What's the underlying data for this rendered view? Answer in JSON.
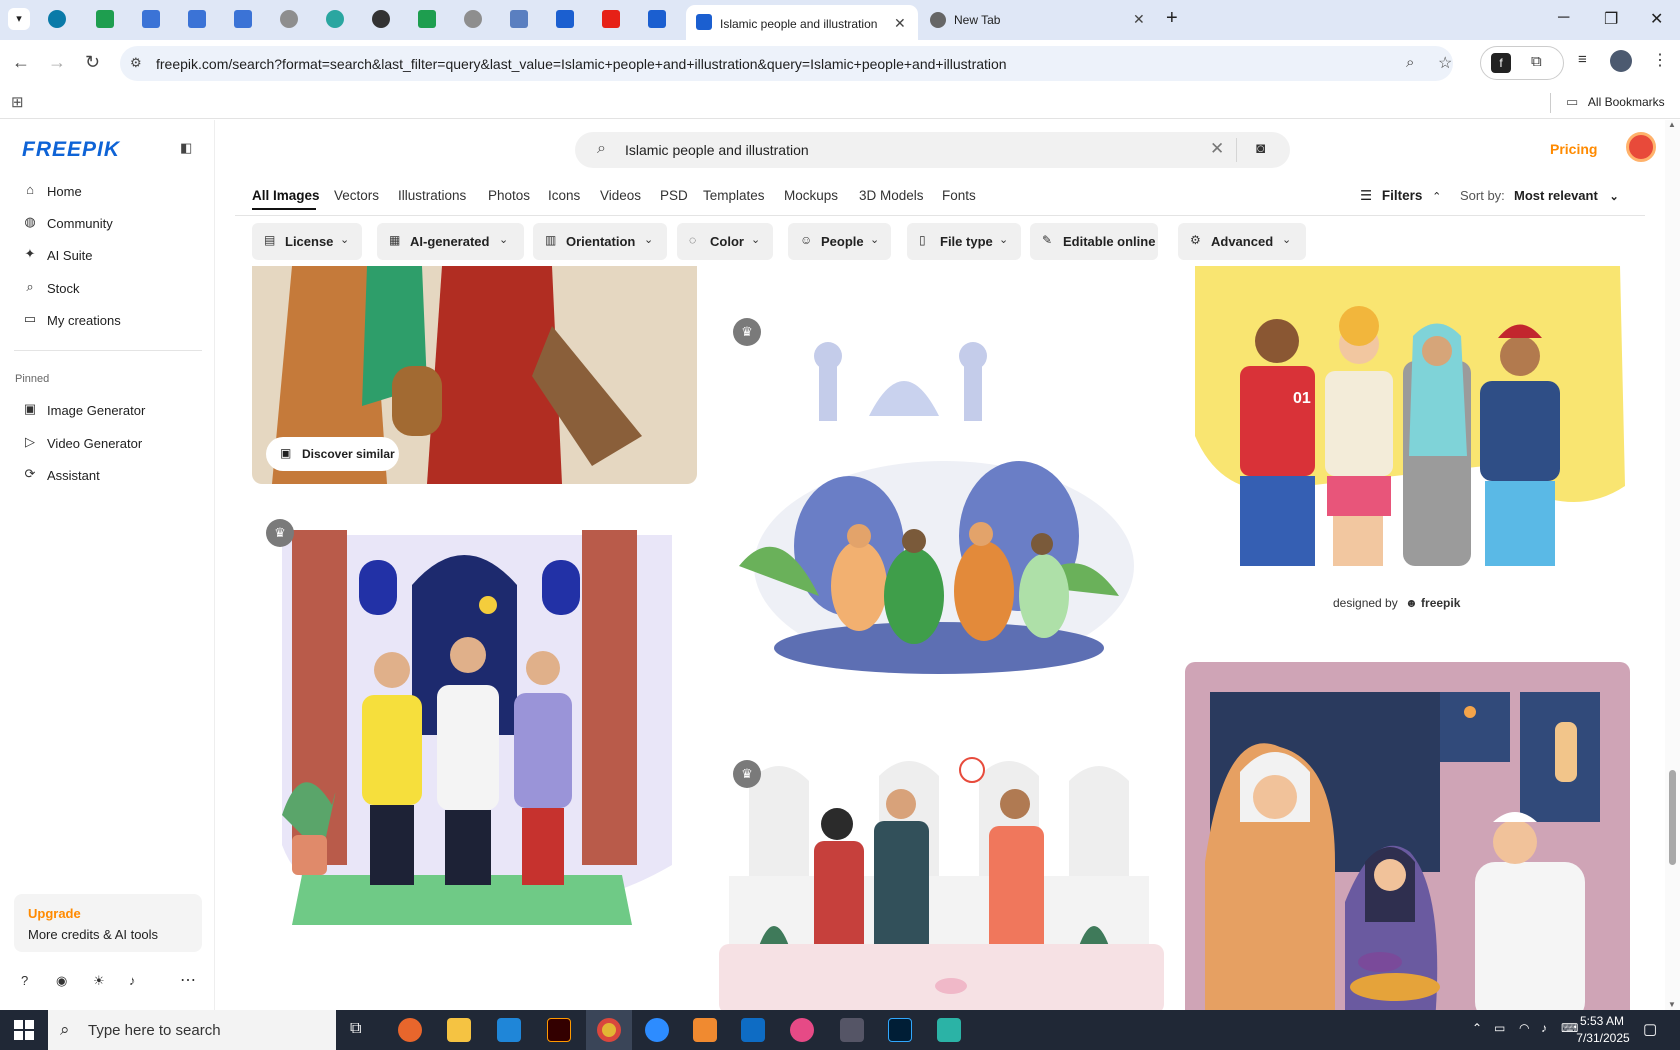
{
  "browser": {
    "tabs": [
      {
        "label": "Islamic people and illustration v",
        "active": true
      },
      {
        "label": "New Tab",
        "active": false
      }
    ],
    "new_tab": "+",
    "url": "freepik.com/search?format=search&last_filter=query&last_value=Islamic+people+and+illustration&query=Islamic+people+and+illustration",
    "all_bookmarks": "All Bookmarks"
  },
  "sidebar": {
    "logo": "FREEPIK",
    "items": [
      {
        "label": "Home",
        "icon": "home-icon"
      },
      {
        "label": "Community",
        "icon": "globe-icon"
      },
      {
        "label": "AI Suite",
        "icon": "sparkle-icon"
      },
      {
        "label": "Stock",
        "icon": "search-icon"
      },
      {
        "label": "My creations",
        "icon": "folder-icon"
      }
    ],
    "pinned_label": "Pinned",
    "pinned": [
      {
        "label": "Image Generator",
        "icon": "image-icon"
      },
      {
        "label": "Video Generator",
        "icon": "video-icon"
      },
      {
        "label": "Assistant",
        "icon": "assistant-icon"
      }
    ],
    "upgrade": {
      "title": "Upgrade",
      "subtitle": "More credits & AI tools"
    }
  },
  "header": {
    "search_value": "Islamic people and illustration",
    "pricing": "Pricing"
  },
  "categories": [
    "All Images",
    "Vectors",
    "Illustrations",
    "Photos",
    "Icons",
    "Videos",
    "PSD",
    "Templates",
    "Mockups",
    "3D Models",
    "Fonts"
  ],
  "filters_label": "Filters",
  "sort_label": "Sort by:",
  "sort_value": "Most relevant",
  "chips": [
    "License",
    "AI-generated",
    "Orientation",
    "Color",
    "People",
    "File type",
    "Editable online",
    "Advanced"
  ],
  "results": {
    "discover_similar": "Discover similar",
    "watermark": "designed by",
    "watermark_brand": "freepik",
    "jersey_number": "01"
  },
  "taskbar": {
    "search_placeholder": "Type here to search",
    "time": "5:53 AM",
    "date": "7/31/2025"
  },
  "colors": {
    "brand": "#0e63d6",
    "accent": "#ff8a00"
  }
}
